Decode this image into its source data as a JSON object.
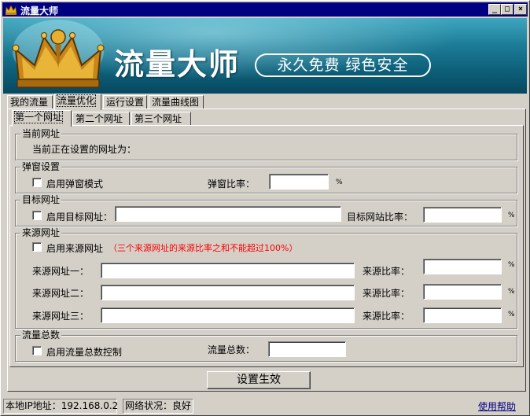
{
  "window": {
    "title": "流量大师",
    "min_btn": "_",
    "max_btn": "□",
    "close_btn": "×"
  },
  "banner": {
    "title": "流量大师",
    "slogan": "永久免费 绿色安全"
  },
  "main_tabs": [
    "我的流量",
    "流量优化",
    "运行设置",
    "流量曲线图"
  ],
  "active_main_tab": "流量优化",
  "sub_tabs": [
    "第一个网址",
    "第二个网址",
    "第三个网址"
  ],
  "active_sub_tab": "第一个网址",
  "current_url": {
    "group_title": "当前网址",
    "text": "当前正在设置的网址为："
  },
  "popup": {
    "group_title": "弹窗设置",
    "checkbox_label": "启用弹窗模式",
    "ratio_label": "弹窗比率：",
    "ratio_value": "",
    "unit": "%"
  },
  "target": {
    "group_title": "目标网址",
    "checkbox_label": "启用目标网址：",
    "url_value": "",
    "ratio_label": "目标网站比率：",
    "ratio_value": "",
    "unit": "%"
  },
  "source": {
    "group_title": "来源网址",
    "checkbox_label": "启用来源网址",
    "warning": "（三个来源网址的来源比率之和不能超过100%）",
    "rows": [
      {
        "label": "来源网址一：",
        "url_value": "",
        "ratio_label": "来源比率：",
        "ratio_value": "",
        "unit": "%"
      },
      {
        "label": "来源网址二：",
        "url_value": "",
        "ratio_label": "来源比率：",
        "ratio_value": "",
        "unit": "%"
      },
      {
        "label": "来源网址三：",
        "url_value": "",
        "ratio_label": "来源比率：",
        "ratio_value": "",
        "unit": "%"
      }
    ]
  },
  "total": {
    "group_title": "流量总数",
    "checkbox_label": "启用流量总数控制",
    "count_label": "流量总数：",
    "count_value": ""
  },
  "apply_button": "设置生效",
  "statusbar": {
    "ip": "本地IP地址：192.168.0.2",
    "network": "网络状况：良好",
    "help": "使用帮助"
  },
  "colors": {
    "title_bar": "#000080",
    "banner": "#1d7d98",
    "warning": "#ff0000"
  }
}
